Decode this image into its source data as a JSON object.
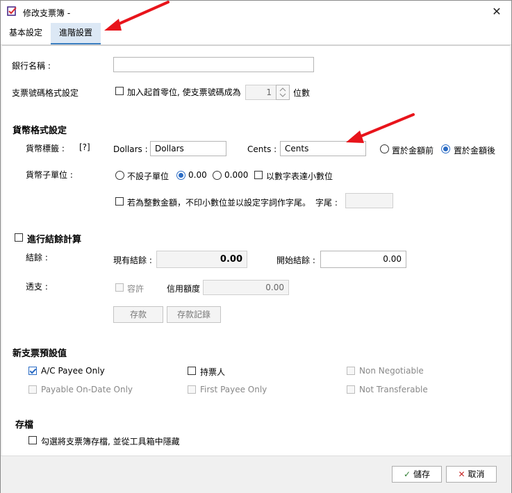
{
  "window": {
    "title": "修改支票簿 -"
  },
  "tabs": [
    {
      "label": "基本設定"
    },
    {
      "label": "進階設置"
    }
  ],
  "fields": {
    "bank_name": {
      "label": "銀行名稱 :",
      "value": ""
    },
    "cheque_no_format": {
      "label": "支票號碼格式設定",
      "checkbox_label": "加入起首零位, 使支票號碼成為",
      "digits_value": "1",
      "digits_unit": "位數"
    }
  },
  "currency_format": {
    "section_title": "貨幣格式設定",
    "tag_label": "貨幣標籤 :",
    "help": "[?]",
    "dollars_label": "Dollars :",
    "dollars_value": "Dollars",
    "cents_label": "Cents :",
    "cents_value": "Cents",
    "position_before": "置於金額前",
    "position_after": "置於金額後",
    "subunit_label": "貨幣子單位 :",
    "subunit_none": "不設子單位",
    "subunit_2": "0.00",
    "subunit_3": "0.000",
    "subunit_numeric": "以數字表達小數位",
    "integer_option": "若為整數金額，不印小數位並以設定字詞作字尾。",
    "suffix_label": "字尾 :",
    "suffix_value": ""
  },
  "balance": {
    "section_title": "進行結餘計算",
    "balance_label": "結餘 :",
    "current_label": "現有結餘 :",
    "current_value": "0.00",
    "opening_label": "開始結餘 :",
    "opening_value": "0.00",
    "overdraft_label": "透支 :",
    "allow_label": "容許",
    "credit_label": "信用額度",
    "credit_value": "0.00",
    "deposit_button": "存款",
    "deposit_record_button": "存款記錄"
  },
  "defaults": {
    "section_title": "新支票預設值",
    "options": [
      {
        "label": "A/C Payee Only"
      },
      {
        "label": "持票人"
      },
      {
        "label": "Non Negotiable"
      },
      {
        "label": "Payable On-Date Only"
      },
      {
        "label": "First Payee Only"
      },
      {
        "label": "Not Transferable"
      }
    ]
  },
  "archive": {
    "section_title": "存檔",
    "checkbox_label": "勾選將支票簿存檔, 並從工具箱中隱藏"
  },
  "footer": {
    "save_label": "儲存",
    "cancel_label": "取消"
  },
  "colors": {
    "accent": "#2a6bc4",
    "annotation_arrow": "#e8141b"
  }
}
